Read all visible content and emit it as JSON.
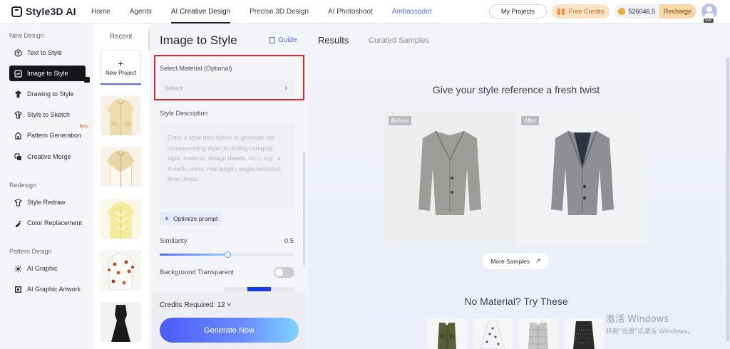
{
  "app": {
    "name": "Style3D AI"
  },
  "nav": {
    "items": [
      "Home",
      "Agents",
      "AI Creative Design",
      "Precise 3D Design",
      "AI Photoshoot",
      "Ambassador"
    ],
    "my_projects": "My Projects",
    "free_credits": "Free Credits",
    "credits": "526046.5",
    "recharge": "Recharge",
    "vip": "VIP"
  },
  "sidebar": {
    "sections": [
      {
        "title": "New Design",
        "items": [
          {
            "label": "Text to Style",
            "icon": "text-style-icon"
          },
          {
            "label": "Image to Style",
            "icon": "image-style-icon",
            "active": true
          },
          {
            "label": "Drawing to Style",
            "icon": "drawing-icon"
          },
          {
            "label": "Style to Sketch",
            "icon": "sketch-icon"
          },
          {
            "label": "Pattern Generation",
            "icon": "pattern-icon",
            "badge": "Beta"
          },
          {
            "label": "Creative Merge",
            "icon": "merge-icon"
          }
        ]
      },
      {
        "title": "Redesign",
        "items": [
          {
            "label": "Style Redraw",
            "icon": "redraw-icon"
          },
          {
            "label": "Color Replacement",
            "icon": "color-icon"
          }
        ]
      },
      {
        "title": "Pattern Design",
        "items": [
          {
            "label": "AI Graphic",
            "icon": "graphic-icon"
          },
          {
            "label": "AI Graphic Artwork",
            "icon": "artwork-icon"
          }
        ]
      }
    ]
  },
  "recent": {
    "title": "Recent",
    "new_project": "New Project",
    "thumbnails": [
      "cream-hoodie",
      "cream-white-hoodie",
      "yellow-jacket",
      "butterfly-print-jacket",
      "black-dress"
    ]
  },
  "panel": {
    "title": "Image to Style",
    "guide": "Guide",
    "material_label": "Select Material (Optional)",
    "material_placeholder": "Select",
    "style_description_label": "Style Description",
    "style_description_placeholder": "Enter a style description to generate the corresponding style (including category, style, material, design details, etc.), e.g., a V-neck, white, mid-length, single-breasted, linen dress.",
    "optimize_prompt": "Optimize prompt",
    "similarity_label": "Similarity",
    "similarity_value": 0.5,
    "background_transparent_label": "Background Transparent",
    "background_transparent": false,
    "credits_required": "Credits Required: 12",
    "generate": "Generate Now"
  },
  "results": {
    "tabs": [
      "Results",
      "Curated Samples"
    ],
    "headline": "Give your style reference a fresh twist",
    "before_label": "Before",
    "after_label": "After",
    "more_samples": "More Samples",
    "no_material": "No Material? Try These",
    "samples": [
      "green-vest",
      "white-patterned-dress",
      "grey-puffer-vest",
      "black-tweed-skirt"
    ]
  },
  "watermark": {
    "line1": "激活 Windows",
    "line2": "转到\"设置\"以激活 Windows。"
  },
  "colors": {
    "accent": "#5b6cff",
    "highlight_border": "#e0262b",
    "active_item_bg": "#14161c",
    "free_credits_bg": "#fde3c6",
    "recharge_bg": "#f7d6a8"
  }
}
